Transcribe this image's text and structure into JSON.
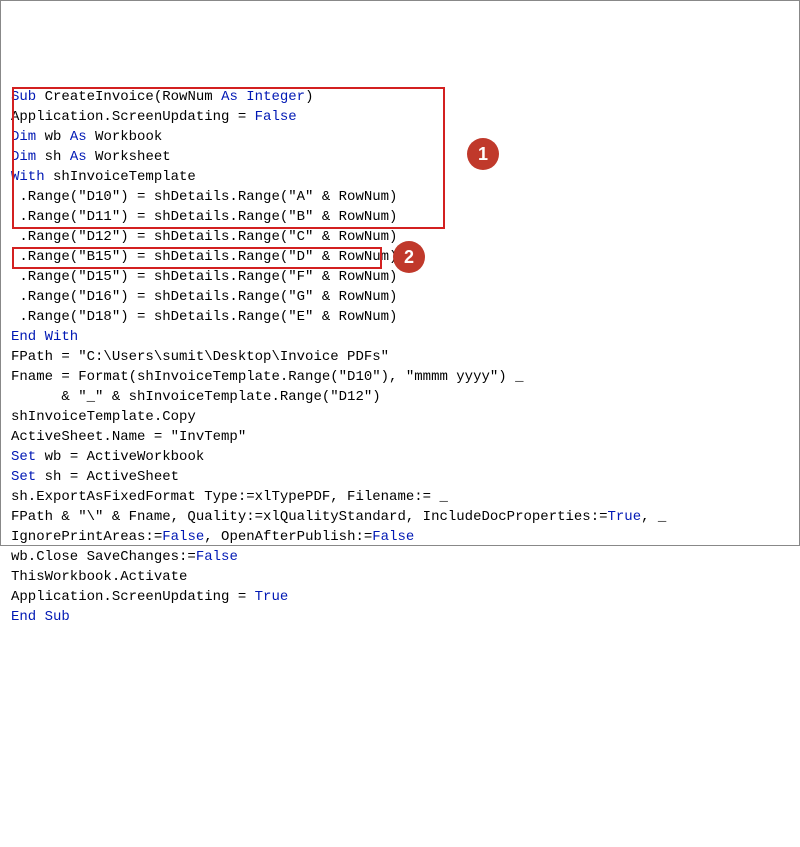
{
  "code": {
    "lines": [
      [
        {
          "cls": "kw",
          "t": "Sub"
        },
        {
          "cls": "txt",
          "t": " CreateInvoice(RowNum "
        },
        {
          "cls": "kw",
          "t": "As Integer"
        },
        {
          "cls": "txt",
          "t": ")"
        }
      ],
      [
        {
          "cls": "txt",
          "t": "Application.ScreenUpdating = "
        },
        {
          "cls": "kw",
          "t": "False"
        }
      ],
      [
        {
          "cls": "kw",
          "t": "Dim"
        },
        {
          "cls": "txt",
          "t": " wb "
        },
        {
          "cls": "kw",
          "t": "As"
        },
        {
          "cls": "txt",
          "t": " Workbook"
        }
      ],
      [
        {
          "cls": "kw",
          "t": "Dim"
        },
        {
          "cls": "txt",
          "t": " sh "
        },
        {
          "cls": "kw",
          "t": "As"
        },
        {
          "cls": "txt",
          "t": " Worksheet"
        }
      ],
      [
        {
          "cls": "kw",
          "t": "With"
        },
        {
          "cls": "txt",
          "t": " shInvoiceTemplate"
        }
      ],
      [
        {
          "cls": "txt",
          "t": " .Range(\"D10\") = shDetails.Range(\"A\" & RowNum)"
        }
      ],
      [
        {
          "cls": "txt",
          "t": " .Range(\"D11\") = shDetails.Range(\"B\" & RowNum)"
        }
      ],
      [
        {
          "cls": "txt",
          "t": " .Range(\"D12\") = shDetails.Range(\"C\" & RowNum)"
        }
      ],
      [
        {
          "cls": "txt",
          "t": " .Range(\"B15\") = shDetails.Range(\"D\" & RowNum)"
        }
      ],
      [
        {
          "cls": "txt",
          "t": " .Range(\"D15\") = shDetails.Range(\"F\" & RowNum)"
        }
      ],
      [
        {
          "cls": "txt",
          "t": " .Range(\"D16\") = shDetails.Range(\"G\" & RowNum)"
        }
      ],
      [
        {
          "cls": "txt",
          "t": " .Range(\"D18\") = shDetails.Range(\"E\" & RowNum)"
        }
      ],
      [
        {
          "cls": "kw",
          "t": "End With"
        }
      ],
      [
        {
          "cls": "txt",
          "t": "FPath = \"C:\\Users\\sumit\\Desktop\\Invoice PDFs\""
        }
      ],
      [
        {
          "cls": "txt",
          "t": "Fname = Format(shInvoiceTemplate.Range(\"D10\"), \"mmmm yyyy\") _"
        }
      ],
      [
        {
          "cls": "txt",
          "t": "      & \"_\" & shInvoiceTemplate.Range(\"D12\")"
        }
      ],
      [
        {
          "cls": "txt",
          "t": "shInvoiceTemplate.Copy"
        }
      ],
      [
        {
          "cls": "txt",
          "t": "ActiveSheet.Name = \"InvTemp\""
        }
      ],
      [
        {
          "cls": "kw",
          "t": "Set"
        },
        {
          "cls": "txt",
          "t": " wb = ActiveWorkbook"
        }
      ],
      [
        {
          "cls": "kw",
          "t": "Set"
        },
        {
          "cls": "txt",
          "t": " sh = ActiveSheet"
        }
      ],
      [
        {
          "cls": "txt",
          "t": "sh.ExportAsFixedFormat Type:=xlTypePDF, Filename:= _"
        }
      ],
      [
        {
          "cls": "txt",
          "t": "FPath & \"\\\" & Fname, Quality:=xlQualityStandard, IncludeDocProperties:="
        },
        {
          "cls": "kw",
          "t": "True"
        },
        {
          "cls": "txt",
          "t": ", _"
        }
      ],
      [
        {
          "cls": "txt",
          "t": "IgnorePrintAreas:="
        },
        {
          "cls": "kw",
          "t": "False"
        },
        {
          "cls": "txt",
          "t": ", OpenAfterPublish:="
        },
        {
          "cls": "kw",
          "t": "False"
        }
      ],
      [
        {
          "cls": "txt",
          "t": "wb.Close SaveChanges:="
        },
        {
          "cls": "kw",
          "t": "False"
        }
      ],
      [
        {
          "cls": "txt",
          "t": "ThisWorkbook.Activate"
        }
      ],
      [
        {
          "cls": "txt",
          "t": "Application.ScreenUpdating = "
        },
        {
          "cls": "kw",
          "t": "True"
        }
      ],
      [
        {
          "cls": "kw",
          "t": "End Sub"
        }
      ]
    ]
  },
  "annotations": {
    "badge1": "1",
    "badge2": "2"
  }
}
